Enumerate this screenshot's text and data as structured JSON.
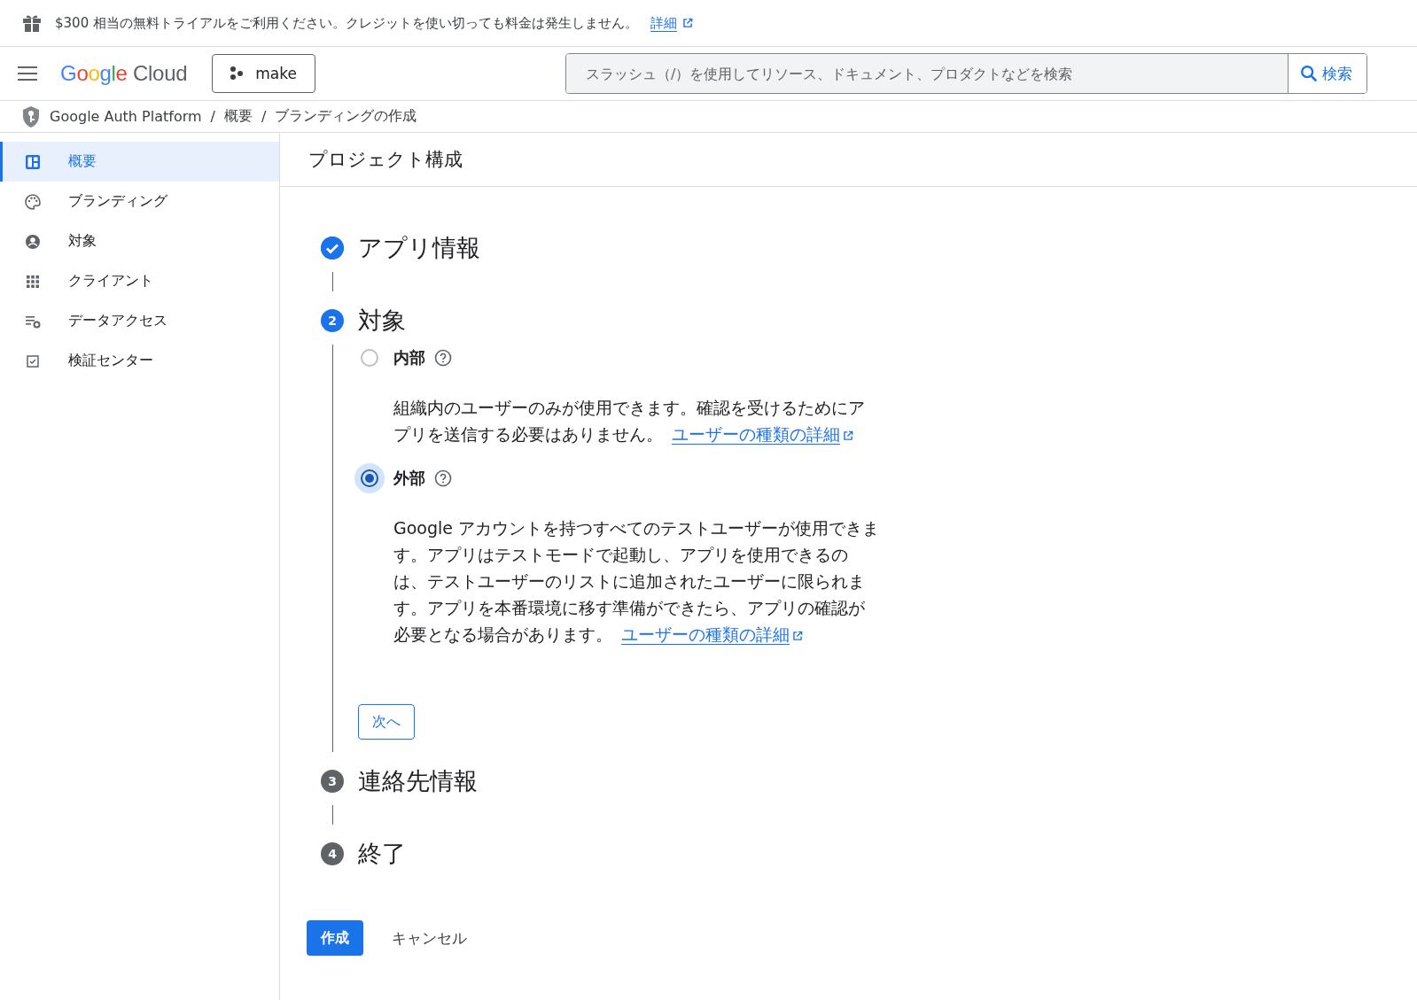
{
  "banner": {
    "text": "$300 相当の無料トライアルをご利用ください。クレジットを使い切っても料金は発生しません。",
    "link": "詳細"
  },
  "header": {
    "logo": {
      "brand": "Google",
      "product": "Cloud"
    },
    "project": "make",
    "search": {
      "placeholder": "スラッシュ（/）を使用してリソース、ドキュメント、プロダクトなどを検索",
      "button": "検索"
    }
  },
  "breadcrumb": {
    "separator": "/",
    "items": [
      "Google Auth Platform",
      "概要",
      "ブランディングの作成"
    ]
  },
  "sidebar": {
    "items": [
      {
        "label": "概要",
        "kind": "dashboard",
        "selected": true
      },
      {
        "label": "ブランディング",
        "kind": "palette",
        "selected": false
      },
      {
        "label": "対象",
        "kind": "person",
        "selected": false
      },
      {
        "label": "クライアント",
        "kind": "grid",
        "selected": false
      },
      {
        "label": "データアクセス",
        "kind": "settings-list",
        "selected": false
      },
      {
        "label": "検証センター",
        "kind": "checkbox",
        "selected": false
      }
    ]
  },
  "page_title": "プロジェクト構成",
  "steps": [
    {
      "kind": "done",
      "title": "アプリ情報"
    },
    {
      "kind": "active",
      "number": "2",
      "title": "対象",
      "options": [
        {
          "label": "内部",
          "selected": false,
          "description": "組織内のユーザーのみが使用できます。確認を受けるためにアプリを送信する必要はありません。",
          "link": "ユーザーの種類の詳細"
        },
        {
          "label": "外部",
          "selected": true,
          "description": "Google アカウントを持つすべてのテストユーザーが使用できます。アプリはテストモードで起動し、アプリを使用できるのは、テストユーザーのリストに追加されたユーザーに限られます。アプリを本番環境に移す準備ができたら、アプリの確認が必要となる場合があります。",
          "link": "ユーザーの種類の詳細"
        }
      ],
      "next_button": "次へ"
    },
    {
      "kind": "pending",
      "number": "3",
      "title": "連絡先情報"
    },
    {
      "kind": "pending",
      "number": "4",
      "title": "終了"
    }
  ],
  "actions": {
    "primary": "作成",
    "secondary": "キャンセル"
  }
}
